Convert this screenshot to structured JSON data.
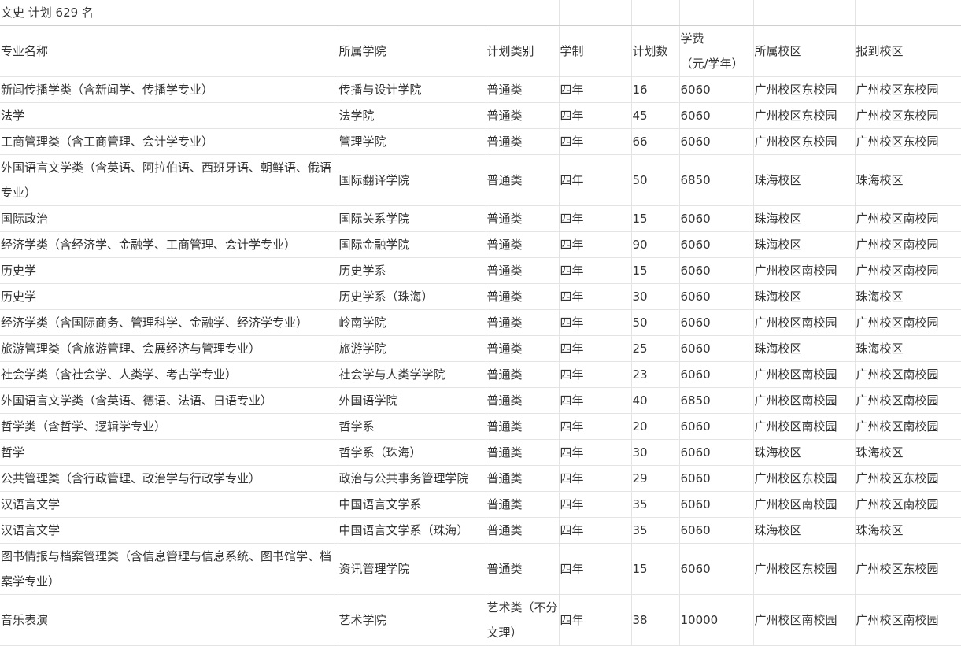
{
  "title": "文史 计划 629 名",
  "headers": {
    "major": "专业名称",
    "college": "所属学院",
    "category": "计划类别",
    "duration": "学制",
    "count": "计划数",
    "fee_line1": "学费",
    "fee_line2": "（元/学年）",
    "campus": "所属校区",
    "report_campus": "报到校区"
  },
  "rows": [
    {
      "major": "新闻传播学类（含新闻学、传播学专业）",
      "college": "传播与设计学院",
      "category": "普通类",
      "duration": "四年",
      "count": "16",
      "fee": "6060",
      "campus": "广州校区东校园",
      "report": "广州校区东校园",
      "h": 1
    },
    {
      "major": "法学",
      "college": "法学院",
      "category": "普通类",
      "duration": "四年",
      "count": "45",
      "fee": "6060",
      "campus": "广州校区东校园",
      "report": "广州校区东校园",
      "h": 1
    },
    {
      "major": "工商管理类（含工商管理、会计学专业）",
      "college": "管理学院",
      "category": "普通类",
      "duration": "四年",
      "count": "66",
      "fee": "6060",
      "campus": "广州校区东校园",
      "report": "广州校区东校园",
      "h": 1
    },
    {
      "major": "外国语言文学类（含英语、阿拉伯语、西班牙语、朝鲜语、俄语专业）",
      "college": "国际翻译学院",
      "category": "普通类",
      "duration": "四年",
      "count": "50",
      "fee": "6850",
      "campus": "珠海校区",
      "report": "珠海校区",
      "h": 2
    },
    {
      "major": "国际政治",
      "college": "国际关系学院",
      "category": "普通类",
      "duration": "四年",
      "count": "15",
      "fee": "6060",
      "campus": "珠海校区",
      "report": "广州校区南校园",
      "h": 1
    },
    {
      "major": "经济学类（含经济学、金融学、工商管理、会计学专业）",
      "college": "国际金融学院",
      "category": "普通类",
      "duration": "四年",
      "count": "90",
      "fee": "6060",
      "campus": "珠海校区",
      "report": "广州校区南校园",
      "h": 1
    },
    {
      "major": "历史学",
      "college": "历史学系",
      "category": "普通类",
      "duration": "四年",
      "count": "15",
      "fee": "6060",
      "campus": "广州校区南校园",
      "report": "广州校区南校园",
      "h": 1
    },
    {
      "major": "历史学",
      "college": "历史学系（珠海）",
      "category": "普通类",
      "duration": "四年",
      "count": "30",
      "fee": "6060",
      "campus": "珠海校区",
      "report": "珠海校区",
      "h": 1
    },
    {
      "major": "经济学类（含国际商务、管理科学、金融学、经济学专业）",
      "college": "岭南学院",
      "category": "普通类",
      "duration": "四年",
      "count": "50",
      "fee": "6060",
      "campus": "广州校区南校园",
      "report": "广州校区南校园",
      "h": 1
    },
    {
      "major": "旅游管理类（含旅游管理、会展经济与管理专业）",
      "college": "旅游学院",
      "category": "普通类",
      "duration": "四年",
      "count": "25",
      "fee": "6060",
      "campus": "珠海校区",
      "report": "珠海校区",
      "h": 1
    },
    {
      "major": "社会学类（含社会学、人类学、考古学专业）",
      "college": "社会学与人类学学院",
      "category": "普通类",
      "duration": "四年",
      "count": "23",
      "fee": "6060",
      "campus": "广州校区南校园",
      "report": "广州校区南校园",
      "h": 1
    },
    {
      "major": "外国语言文学类（含英语、德语、法语、日语专业）",
      "college": "外国语学院",
      "category": "普通类",
      "duration": "四年",
      "count": "40",
      "fee": "6850",
      "campus": "广州校区南校园",
      "report": "广州校区南校园",
      "h": 1
    },
    {
      "major": "哲学类（含哲学、逻辑学专业）",
      "college": "哲学系",
      "category": "普通类",
      "duration": "四年",
      "count": "20",
      "fee": "6060",
      "campus": "广州校区南校园",
      "report": "广州校区南校园",
      "h": 1
    },
    {
      "major": "哲学",
      "college": "哲学系（珠海）",
      "category": "普通类",
      "duration": "四年",
      "count": "30",
      "fee": "6060",
      "campus": "珠海校区",
      "report": "珠海校区",
      "h": 1
    },
    {
      "major": "公共管理类（含行政管理、政治学与行政学专业）",
      "college": "政治与公共事务管理学院",
      "category": "普通类",
      "duration": "四年",
      "count": "29",
      "fee": "6060",
      "campus": "广州校区东校园",
      "report": "广州校区东校园",
      "h": 1
    },
    {
      "major": "汉语言文学",
      "college": "中国语言文学系",
      "category": "普通类",
      "duration": "四年",
      "count": "35",
      "fee": "6060",
      "campus": "广州校区南校园",
      "report": "广州校区南校园",
      "h": 1
    },
    {
      "major": "汉语言文学",
      "college": "中国语言文学系（珠海）",
      "category": "普通类",
      "duration": "四年",
      "count": "35",
      "fee": "6060",
      "campus": "珠海校区",
      "report": "珠海校区",
      "h": 1
    },
    {
      "major": "图书情报与档案管理类（含信息管理与信息系统、图书馆学、档案学专业）",
      "college": "资讯管理学院",
      "category": "普通类",
      "duration": "四年",
      "count": "15",
      "fee": "6060",
      "campus": "广州校区东校园",
      "report": "广州校区东校园",
      "h": 2
    },
    {
      "major": "音乐表演",
      "college": "艺术学院",
      "category": "艺术类（不分文理）",
      "duration": "四年",
      "count": "38",
      "fee": "10000",
      "campus": "广州校区南校园",
      "report": "广州校区南校园",
      "h": 2
    }
  ]
}
